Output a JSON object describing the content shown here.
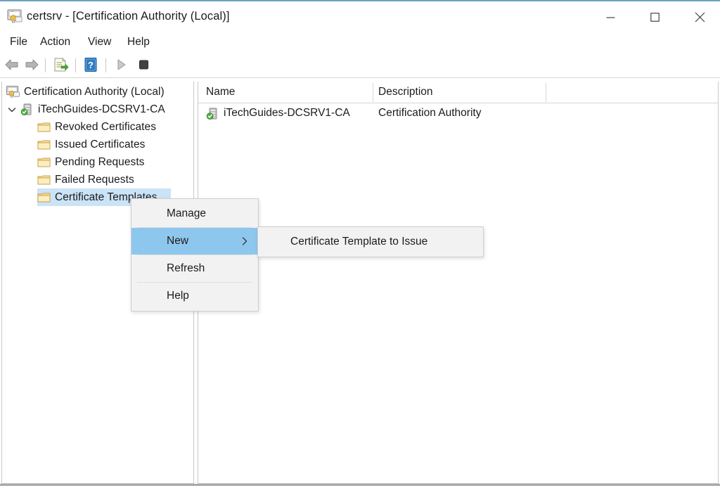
{
  "window": {
    "title": "certsrv - [Certification Authority (Local)]",
    "app_icon": "certification-authority-icon",
    "controls": {
      "minimize": "—",
      "maximize": "□",
      "close": "✕"
    }
  },
  "menubar": {
    "items": [
      {
        "label": "File"
      },
      {
        "label": "Action"
      },
      {
        "label": "View"
      },
      {
        "label": "Help"
      }
    ]
  },
  "toolbar": {
    "buttons": [
      {
        "name": "back-icon",
        "tooltip": "Back"
      },
      {
        "name": "forward-icon",
        "tooltip": "Forward"
      },
      {
        "name": "export-list-icon",
        "tooltip": "Export List"
      },
      {
        "name": "help-icon",
        "tooltip": "Help"
      },
      {
        "name": "start-icon",
        "tooltip": "Start Service"
      },
      {
        "name": "stop-icon",
        "tooltip": "Stop Service"
      }
    ]
  },
  "tree": {
    "nodes": [
      {
        "label": "Certification Authority (Local)",
        "icon": "certification-authority-icon",
        "indent": 0,
        "expander": "none",
        "selected": false
      },
      {
        "label": "iTechGuides-DCSRV1-CA",
        "icon": "ca-server-icon",
        "indent": 1,
        "expander": "expanded",
        "selected": false
      },
      {
        "label": "Revoked Certificates",
        "icon": "folder-icon",
        "indent": 2,
        "expander": "none",
        "selected": false
      },
      {
        "label": "Issued Certificates",
        "icon": "folder-icon",
        "indent": 2,
        "expander": "none",
        "selected": false
      },
      {
        "label": "Pending Requests",
        "icon": "folder-icon",
        "indent": 2,
        "expander": "none",
        "selected": false
      },
      {
        "label": "Failed Requests",
        "icon": "folder-icon",
        "indent": 2,
        "expander": "none",
        "selected": false
      },
      {
        "label": "Certificate Templates",
        "icon": "folder-icon",
        "indent": 2,
        "expander": "none",
        "selected": true
      }
    ]
  },
  "list": {
    "columns": [
      {
        "label": "Name"
      },
      {
        "label": "Description"
      }
    ],
    "rows": [
      {
        "name": "iTechGuides-DCSRV1-CA",
        "description": "Certification Authority",
        "icon": "ca-server-icon"
      }
    ]
  },
  "context_menu": {
    "items": [
      {
        "label": "Manage",
        "highlighted": false,
        "has_submenu": false
      },
      {
        "label": "New",
        "highlighted": true,
        "has_submenu": true
      },
      {
        "label": "Refresh",
        "highlighted": false,
        "has_submenu": false
      },
      {
        "label": "Help",
        "highlighted": false,
        "has_submenu": false
      }
    ]
  },
  "submenu": {
    "items": [
      {
        "label": "Certificate Template to Issue"
      }
    ]
  },
  "colors": {
    "selection_tree": "#cbe3f7",
    "menu_highlight": "#8ec7ee",
    "menu_background": "#f2f2f2",
    "title_accent": "#6ba3c4",
    "status_green": "#3faa3f"
  }
}
